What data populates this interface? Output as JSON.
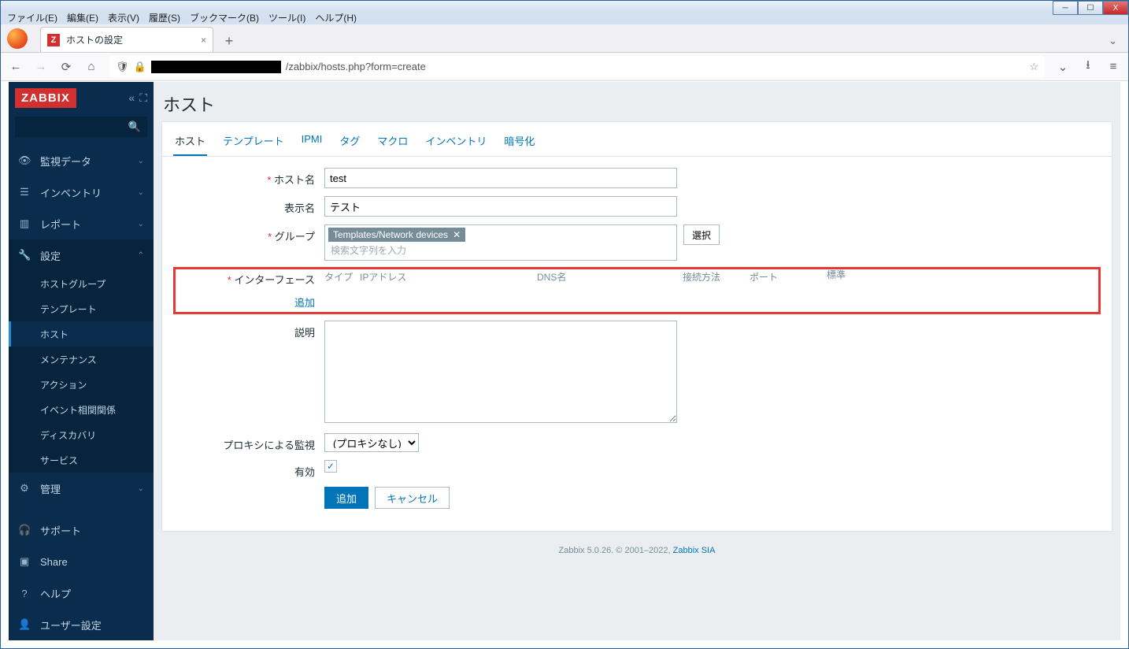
{
  "window": {
    "menubar": [
      "ファイル(E)",
      "編集(E)",
      "表示(V)",
      "履歴(S)",
      "ブックマーク(B)",
      "ツール(I)",
      "ヘルプ(H)"
    ]
  },
  "browser": {
    "tab_title": "ホストの設定",
    "url": "/zabbix/hosts.php?form=create"
  },
  "sidebar": {
    "logo": "ZABBIX",
    "sections": {
      "monitoring": "監視データ",
      "inventory": "インベントリ",
      "reports": "レポート",
      "config": "設定",
      "admin": "管理"
    },
    "config_items": [
      "ホストグループ",
      "テンプレート",
      "ホスト",
      "メンテナンス",
      "アクション",
      "イベント相関関係",
      "ディスカバリ",
      "サービス"
    ],
    "bottom": {
      "support": "サポート",
      "share": "Share",
      "help": "ヘルプ",
      "user": "ユーザー設定"
    }
  },
  "page": {
    "title": "ホスト",
    "tabs": [
      "ホスト",
      "テンプレート",
      "IPMI",
      "タグ",
      "マクロ",
      "インベントリ",
      "暗号化"
    ],
    "labels": {
      "hostname": "ホスト名",
      "visible": "表示名",
      "groups": "グループ",
      "interfaces": "インターフェース",
      "description": "説明",
      "proxy": "プロキシによる監視",
      "enabled": "有効"
    },
    "values": {
      "hostname": "test",
      "visible": "テスト",
      "group_tag": "Templates/Network devices",
      "group_placeholder": "検索文字列を入力",
      "select_btn": "選択",
      "proxy_option": "(プロキシなし)",
      "add_link": "追加"
    },
    "iface_headers": {
      "type": "タイプ",
      "ip": "IPアドレス",
      "dns": "DNS名",
      "conn": "接続方法",
      "port": "ポート",
      "def": "標準"
    },
    "buttons": {
      "submit": "追加",
      "cancel": "キャンセル"
    }
  },
  "footer": {
    "text": "Zabbix 5.0.26. © 2001–2022, ",
    "link": "Zabbix SIA"
  }
}
